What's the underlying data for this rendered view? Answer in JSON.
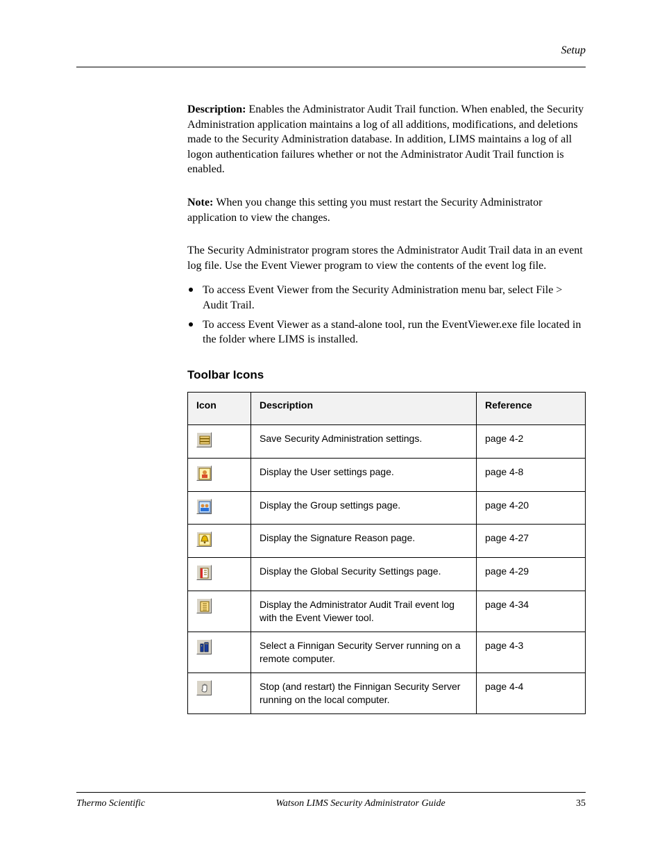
{
  "running_head": "Setup",
  "paragraphs": {
    "p1_lead": "Description: ",
    "p1_rest": "Enables the Administrator Audit Trail function. When enabled, the Security Administration application maintains a log of all additions, modifications, and deletions made to the Security Administration database. In addition, LIMS maintains a log of all logon authentication failures whether or not the Administrator Audit Trail function is enabled.",
    "note_lead": "Note: ",
    "note_rest": "When you change this setting you must restart the Security Administrator application to view the changes.",
    "p2": "The Security Administrator program stores the Administrator Audit Trail data in an event log file. Use the Event Viewer program to view the contents of the event log file.",
    "b1": "To access Event Viewer from the Security Administration menu bar, select File > Audit Trail.",
    "b2": "To access Event Viewer as a stand-alone tool, run the EventViewer.exe file located in the folder where LIMS is installed."
  },
  "subhead": "Toolbar Icons",
  "table": {
    "headers": [
      "Icon",
      "Description",
      "Reference"
    ],
    "rows": [
      {
        "icon_name": "save-settings-icon",
        "svg_key": "save",
        "desc": "Save Security Administration settings.",
        "ref": "page 4-2"
      },
      {
        "icon_name": "user-settings-page-icon",
        "svg_key": "user",
        "desc": "Display the User settings page.",
        "ref": "page 4-8"
      },
      {
        "icon_name": "group-settings-page-icon",
        "svg_key": "group",
        "desc": "Display the Group settings page.",
        "ref": "page 4-20"
      },
      {
        "icon_name": "signature-reason-page-icon",
        "svg_key": "bell",
        "desc": "Display the Signature Reason page.",
        "ref": "page 4-27"
      },
      {
        "icon_name": "global-security-settings-page-icon",
        "svg_key": "doc-red",
        "desc": "Display the Global Security Settings page.",
        "ref": "page 4-29"
      },
      {
        "icon_name": "audit-trail-log-icon",
        "svg_key": "doc-yellow",
        "desc": "Display the Administrator Audit Trail event log with the Event Viewer tool.",
        "ref": "page 4-34"
      },
      {
        "icon_name": "select-security-server-icon",
        "svg_key": "towers",
        "desc": "Select a Finnigan Security Server running on a remote computer.",
        "ref": "page 4-3"
      },
      {
        "icon_name": "stop-security-server-icon",
        "svg_key": "hand",
        "desc": "Stop (and restart) the Finnigan Security Server running on the local computer.",
        "ref": "page 4-4"
      }
    ]
  },
  "footer": {
    "left": "Thermo Scientific",
    "center": "Watson LIMS Security Administrator Guide",
    "page": "35"
  },
  "svg": {
    "save": "<rect x='2' y='3' width='14' height='3' fill='#ffe08a' stroke='#7a5b00'/><rect x='2' y='7' width='14' height='3' fill='#ffe08a' stroke='#7a5b00'/><rect x='2' y='11' width='14' height='3' fill='#ffe08a' stroke='#7a5b00'/>",
    "user": "<rect x='1' y='1' width='16' height='16' fill='#fff2b0' stroke='#7a5b00'/><circle cx='9' cy='7' r='3' fill='#d98c3a'/><rect x='5' y='10' width='8' height='5' fill='#d94b2a'/>",
    "group": "<rect x='1' y='1' width='16' height='16' fill='#cfe8ff' stroke='#2a5aa0'/><circle cx='6' cy='7' r='2.4' fill='#d98c3a'/><circle cx='12' cy='7' r='2.4' fill='#d98c3a'/><rect x='3' y='10' width='12' height='5' fill='#2a72d9'/>",
    "bell": "<rect x='1' y='1' width='16' height='16' fill='#fff2b0' stroke='#b58b00'/><path d='M9 3 C5 3 5 9 4 11 L14 11 C13 9 13 3 9 3 Z' fill='#e6b800' stroke='#7a5b00'/><circle cx='9' cy='13' r='1.4' fill='#7a5b00'/>",
    "doc-red": "<rect x='3' y='2' width='11' height='14' fill='#fff' stroke='#7a5b00'/><rect x='3' y='2' width='3' height='14' fill='#d92a2a'/><line x1='8' y1='5' x2='12' y2='5' stroke='#7a5b00'/><line x1='8' y1='8' x2='12' y2='8' stroke='#7a5b00'/><line x1='8' y1='11' x2='12' y2='11' stroke='#7a5b00'/>",
    "doc-yellow": "<rect x='3' y='2' width='12' height='14' fill='#ffe08a' stroke='#7a5b00'/><line x1='6' y1='5' x2='12' y2='5' stroke='#7a5b00'/><line x1='6' y1='8' x2='12' y2='8' stroke='#7a5b00'/><line x1='6' y1='11' x2='12' y2='11' stroke='#7a5b00'/><line x1='6' y1='14' x2='12' y2='14' stroke='#7a5b00'/>",
    "towers": "<rect x='3' y='4' width='4' height='11' fill='#1a3ea0' stroke='#0c2050'/><rect x='9' y='2' width='5' height='13' fill='#1a3ea0' stroke='#0c2050'/><rect x='10' y='3' width='1.2' height='1.2' fill='#ffd040'/><rect x='12' y='3' width='1.2' height='1.2' fill='#ffd040'/><rect x='4' y='6' width='1.2' height='1.2' fill='#ffd040'/>",
    "hand": "<path d='M6 10 L6 5 Q6 4 7 4 Q8 4 8 5 L8 4 Q8 3 9 3 Q10 3 10 4 L10 5 Q10 4 11 4 Q12 4 12 5 L12 10 Q12 14 9 14 Q5 14 5 11 Z' fill='#fff' stroke='#555'/>"
  }
}
